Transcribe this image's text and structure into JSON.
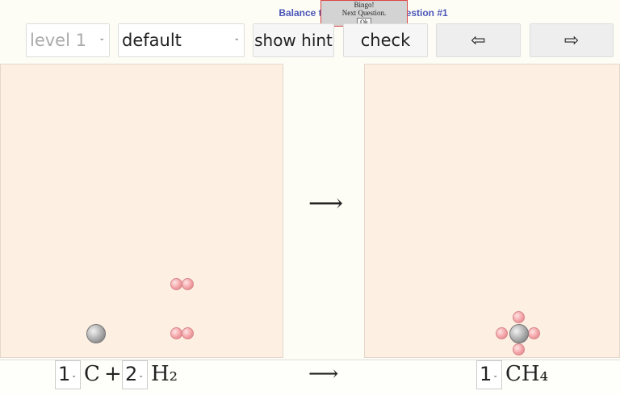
{
  "title": "Balance the Equation — Question #1",
  "popup": {
    "line1": "Bingo!",
    "line2": "Next Question.",
    "ok_label": "Ok"
  },
  "controls": {
    "level": "level 1",
    "scheme": "default",
    "hint_label": "show hint",
    "check_label": "check",
    "prev_icon": "⇦",
    "next_icon": "⇨"
  },
  "reaction_arrow": "⟶",
  "equation": {
    "reactant1_coef": "1",
    "reactant1": "C",
    "plus": "+",
    "reactant2_coef": "2",
    "reactant2": "H₂",
    "product1_coef": "1",
    "product1": "CH₄"
  },
  "colors": {
    "title": "#4b55b8",
    "panel": "#fdf0e3",
    "hydrogen": "#f3a3a6",
    "carbon": "#a8a8a8"
  }
}
